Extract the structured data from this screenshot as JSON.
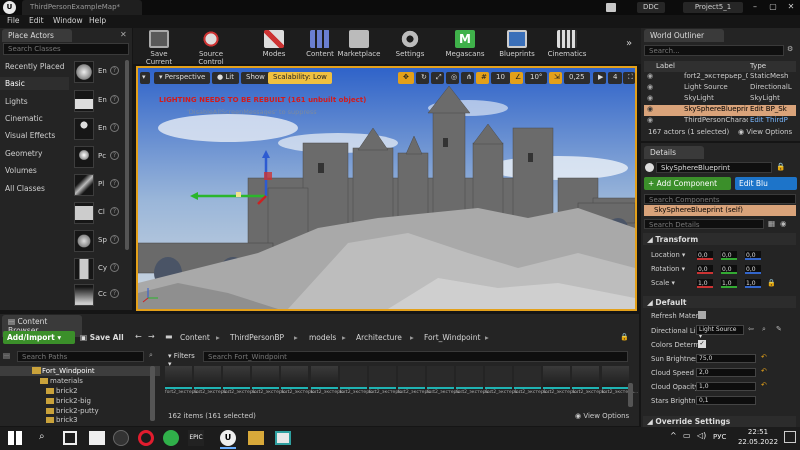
{
  "window": {
    "doc_tab": "ThirdPersonExampleMap*",
    "ddc": "DDC",
    "project": "Project5_1"
  },
  "menu": [
    "File",
    "Edit",
    "Window",
    "Help"
  ],
  "place_actors": {
    "tab": "Place Actors",
    "search_placeholder": "Search Classes",
    "categories": [
      "Recently Placed",
      "Basic",
      "Lights",
      "Cinematic",
      "Visual Effects",
      "Geometry",
      "Volumes",
      "All Classes"
    ],
    "actors": [
      "En",
      "En",
      "En",
      "Pc",
      "Pl",
      "Cl",
      "Sp",
      "Cy",
      "Cc"
    ]
  },
  "toolbar": [
    {
      "label": "Save Current",
      "icon": "save-icon"
    },
    {
      "label": "Source Control",
      "icon": "source-control-icon"
    },
    {
      "label": "Modes",
      "icon": "modes-icon"
    },
    {
      "label": "Content",
      "icon": "content-icon"
    },
    {
      "label": "Marketplace",
      "icon": "marketplace-icon"
    },
    {
      "label": "Settings",
      "icon": "settings-icon"
    },
    {
      "label": "Megascans",
      "icon": "megascans-icon"
    },
    {
      "label": "Blueprints",
      "icon": "blueprints-icon"
    },
    {
      "label": "Cinematics",
      "icon": "cinematics-icon"
    }
  ],
  "viewport": {
    "perspective": "Perspective",
    "lit": "Lit",
    "show": "Show",
    "scalability": "Scalability: Low",
    "grid_snap": "10",
    "rot_snap": "10°",
    "scale_snap": "0,25",
    "cam_speed": "4",
    "warning": "LIGHTING NEEDS TO BE REBUILT (161 unbuilt object)",
    "suppress": "'DisableAllScreenMessages' to suppress"
  },
  "outliner": {
    "tab": "World Outliner",
    "search_placeholder": "Search...",
    "col_label": "Label",
    "col_type": "Type",
    "rows": [
      {
        "label": "fort2_экстерьер_02",
        "type": "StaticMesh"
      },
      {
        "label": "Light Source",
        "type": "DirectionalL"
      },
      {
        "label": "SkyLight",
        "type": "SkyLight"
      },
      {
        "label": "SkySphereBlueprint",
        "type": "Edit BP_Sk"
      },
      {
        "label": "ThirdPersonCharact",
        "type": "Edit ThirdP"
      }
    ],
    "count": "167 actors (1 selected)",
    "view_options": "View Options"
  },
  "details": {
    "tab": "Details",
    "name": "SkySphereBlueprint",
    "add_component": "+ Add Component",
    "edit_blueprint": "Edit Blu",
    "search_components": "Search Components",
    "self": "SkySphereBlueprint (self)",
    "search_details": "Search Details",
    "transform": "Transform",
    "location": "Location",
    "rotation": "Rotation",
    "scale": "Scale",
    "loc_vals": [
      "0,0",
      "0,0",
      "0,0"
    ],
    "rot_vals": [
      "0,0",
      "0,0",
      "0,0"
    ],
    "scale_vals": [
      "1,0",
      "1,0",
      "1,0"
    ],
    "default": "Default",
    "refresh": "Refresh Mater",
    "dir_light": "Directional Lig",
    "dir_light_val": "Light Source",
    "colors_determ": "Colors Determ",
    "sun_brightness": "Sun Brightnes",
    "sun_val": "75,0",
    "cloud_speed": "Cloud Speed",
    "cloud_speed_val": "2,0",
    "cloud_opacity": "Cloud Opacity",
    "cloud_opacity_val": "1,0",
    "stars": "Stars Brightne",
    "stars_val": "0,1",
    "override": "Override Settings"
  },
  "content_browser": {
    "tab": "Content Browser",
    "add_import": "Add/Import",
    "save_all": "Save All",
    "path": [
      "Content",
      "ThirdPersonBP",
      "models",
      "Architecture",
      "Fort_Windpoint"
    ],
    "search_paths": "Search Paths",
    "filters": "Filters",
    "search_assets": "Search Fort_Windpoint",
    "tree": [
      "Fort_Windpoint",
      "materials",
      "brick2",
      "brick2-big",
      "brick2-putty",
      "brick3"
    ],
    "asset_name": "fort2_экстерь...",
    "items": "162 items (161 selected)",
    "view_options": "View Options"
  },
  "taskbar": {
    "lang": "РУС",
    "time": "22:51",
    "date": "22.05.2022"
  },
  "colors": {
    "accent_orange": "#e3a01a",
    "selection": "#d9a37a",
    "add_green": "#3b8f2a",
    "edit_blue": "#1d74c9",
    "teal": "#1fb3b3"
  }
}
